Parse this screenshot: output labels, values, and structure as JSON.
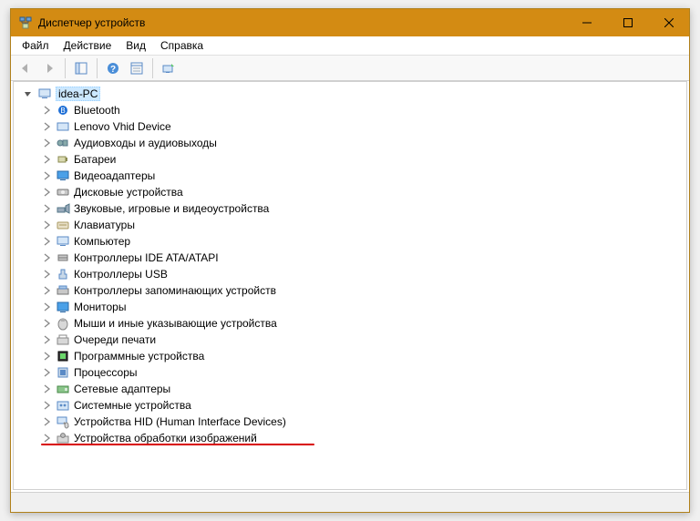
{
  "window": {
    "title": "Диспетчер устройств"
  },
  "menus": [
    "Файл",
    "Действие",
    "Вид",
    "Справка"
  ],
  "tree": {
    "root": "idea-PC",
    "items": [
      "Bluetooth",
      "Lenovo Vhid Device",
      "Аудиовходы и аудиовыходы",
      "Батареи",
      "Видеоадаптеры",
      "Дисковые устройства",
      "Звуковые, игровые и видеоустройства",
      "Клавиатуры",
      "Компьютер",
      "Контроллеры IDE ATA/ATAPI",
      "Контроллеры USB",
      "Контроллеры запоминающих устройств",
      "Мониторы",
      "Мыши и иные указывающие устройства",
      "Очереди печати",
      "Программные устройства",
      "Процессоры",
      "Сетевые адаптеры",
      "Системные устройства",
      "Устройства HID (Human Interface Devices)",
      "Устройства обработки изображений"
    ]
  }
}
